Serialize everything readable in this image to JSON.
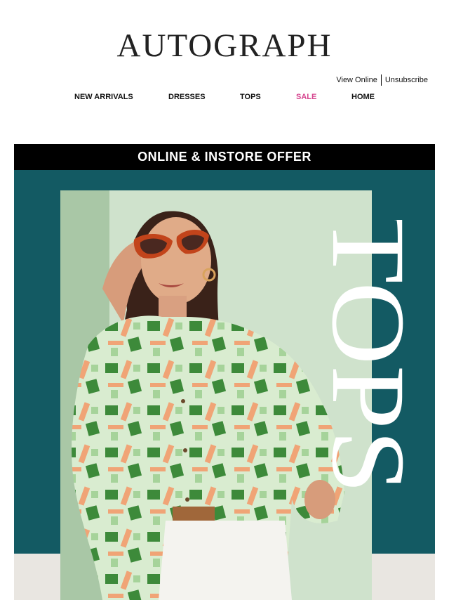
{
  "brand": {
    "logo_text": "AUTOGRAPH"
  },
  "header_links": {
    "view_online": "View Online",
    "unsubscribe": "Unsubscribe"
  },
  "nav": {
    "items": [
      {
        "label": "NEW ARRIVALS",
        "color": "#111111"
      },
      {
        "label": "DRESSES",
        "color": "#111111"
      },
      {
        "label": "TOPS",
        "color": "#111111"
      },
      {
        "label": "SALE",
        "color": "#d6458f"
      },
      {
        "label": "HOME",
        "color": "#111111"
      }
    ]
  },
  "hero": {
    "offer_banner": "ONLINE & INSTORE OFFER",
    "headline": "TOPS",
    "colors": {
      "banner_bg": "#000000",
      "panel_bg": "#135a63",
      "headline": "#ffffff"
    }
  }
}
